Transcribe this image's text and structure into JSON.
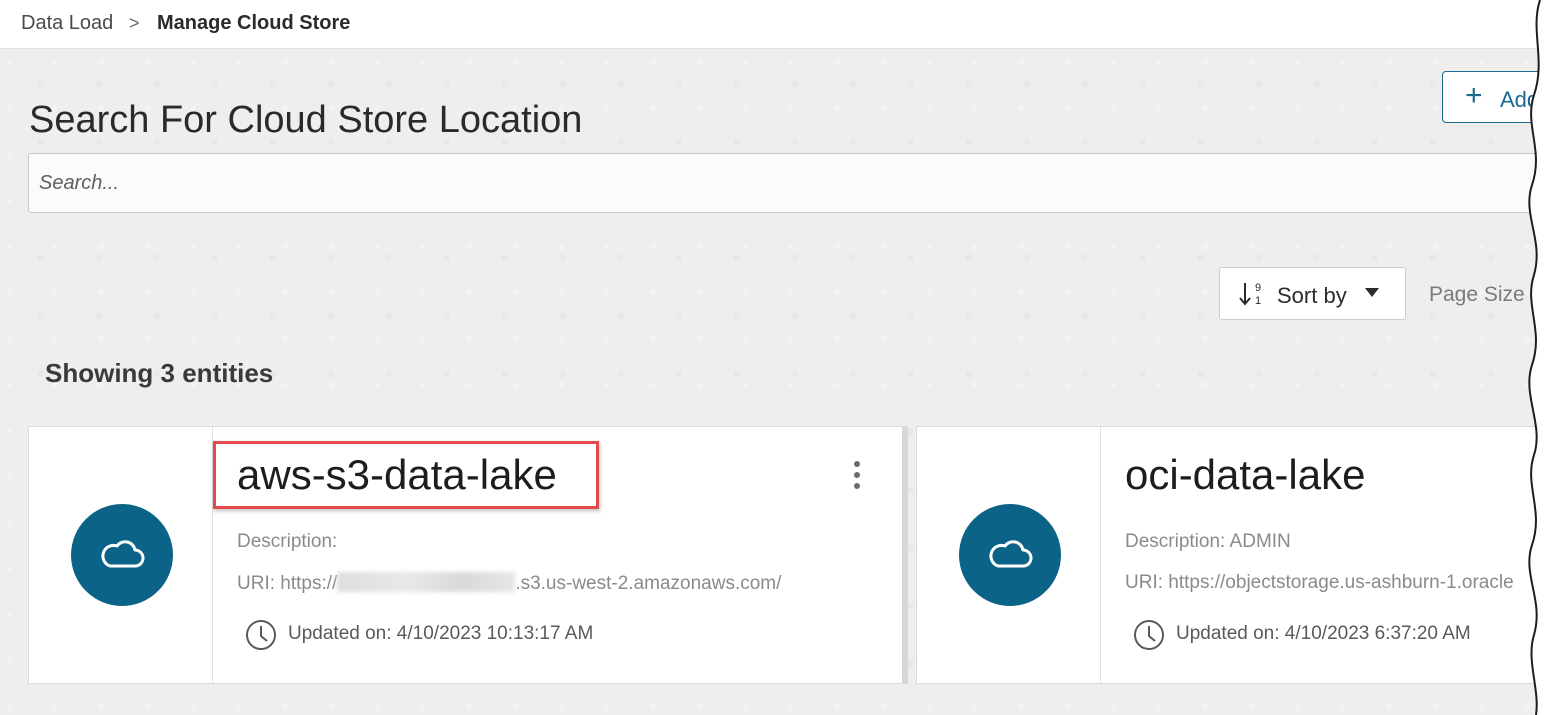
{
  "breadcrumb": {
    "root": "Data Load",
    "separator": ">",
    "current": "Manage Cloud Store"
  },
  "page": {
    "title": "Search For Cloud Store Location",
    "add_button_label": "Add",
    "search_placeholder": "Search..."
  },
  "toolbar": {
    "sort_label": "Sort by",
    "page_size_label": "Page Size"
  },
  "results": {
    "count_text": "Showing 3 entities"
  },
  "cards": [
    {
      "name": "aws-s3-data-lake",
      "description": "Description:",
      "uri_prefix": "URI: https://",
      "uri_suffix": ".s3.us-west-2.amazonaws.com/",
      "updated": "Updated on: 4/10/2023 10:13:17 AM",
      "icon": "cloud-icon"
    },
    {
      "name": "oci-data-lake",
      "description": "Description: ADMIN",
      "uri": "URI: https://objectstorage.us-ashburn-1.oracle",
      "updated": "Updated on: 4/10/2023 6:37:20 AM",
      "icon": "cloud-icon"
    }
  ],
  "colors": {
    "accent": "#0b6487",
    "highlight": "#e5484d",
    "button_border": "#1a6a8e"
  }
}
